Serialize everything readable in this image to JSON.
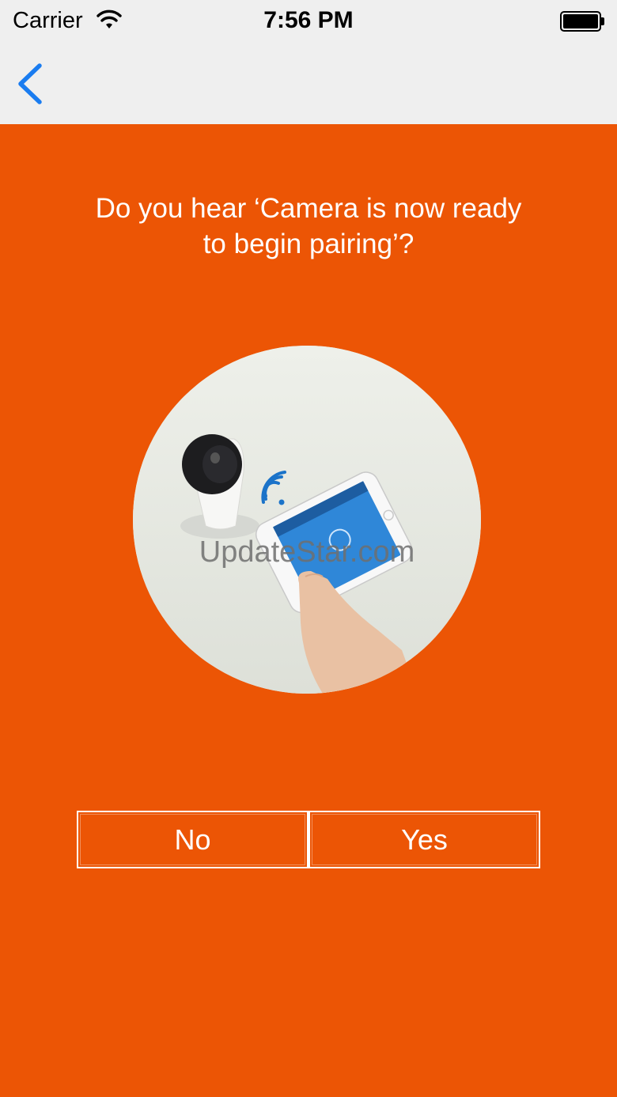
{
  "status_bar": {
    "carrier": "Carrier",
    "time": "7:56 PM",
    "wifi_icon": "wifi-icon",
    "battery_icon": "battery-icon"
  },
  "nav_bar": {
    "back_icon": "chevron-left-icon"
  },
  "content": {
    "prompt_line1": "Do you hear ‘Camera  is now ready",
    "prompt_line2": "to begin pairing’?",
    "watermark": "UpdateStar.com"
  },
  "buttons": {
    "no_label": "No",
    "yes_label": "Yes"
  },
  "colors": {
    "accent": "#ec5505",
    "nav_background": "#efefef",
    "ios_blue": "#1a7cf0"
  }
}
